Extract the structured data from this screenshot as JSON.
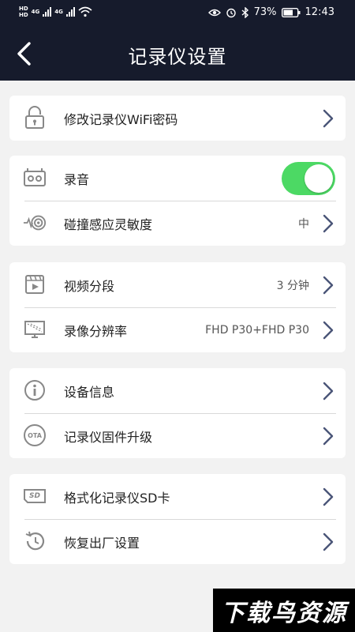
{
  "status_bar": {
    "left": {
      "hd1": "HD",
      "hd2": "HD",
      "net1": "4G",
      "net2": "4G"
    },
    "battery": "73%",
    "time": "12:43"
  },
  "app_bar": {
    "title": "记录仪设置"
  },
  "groups": [
    {
      "items": [
        {
          "icon": "lock-icon",
          "label": "修改记录仪WiFi密码"
        }
      ]
    },
    {
      "items": [
        {
          "icon": "recorder-icon",
          "label": "录音",
          "toggle_on": true
        },
        {
          "icon": "collision-sensor-icon",
          "label": "碰撞感应灵敏度",
          "value": "中"
        }
      ]
    },
    {
      "items": [
        {
          "icon": "video-icon",
          "label": "视频分段",
          "value": "3 分钟"
        },
        {
          "icon": "resolution-icon",
          "label": "录像分辨率",
          "value": "FHD P30+FHD P30"
        }
      ]
    },
    {
      "items": [
        {
          "icon": "info-icon",
          "label": "设备信息"
        },
        {
          "icon": "ota-icon",
          "label": "记录仪固件升级",
          "icon_text": "OTA"
        }
      ]
    },
    {
      "items": [
        {
          "icon": "sd-card-icon",
          "label": "格式化记录仪SD卡",
          "icon_text": "SD"
        },
        {
          "icon": "restore-icon",
          "label": "恢复出厂设置"
        }
      ]
    }
  ],
  "watermark": "下载鸟资源",
  "colors": {
    "header": "#161b2c",
    "toggle_on": "#4cd964",
    "chevron": "#4a5578",
    "background": "#f2f2f2"
  }
}
